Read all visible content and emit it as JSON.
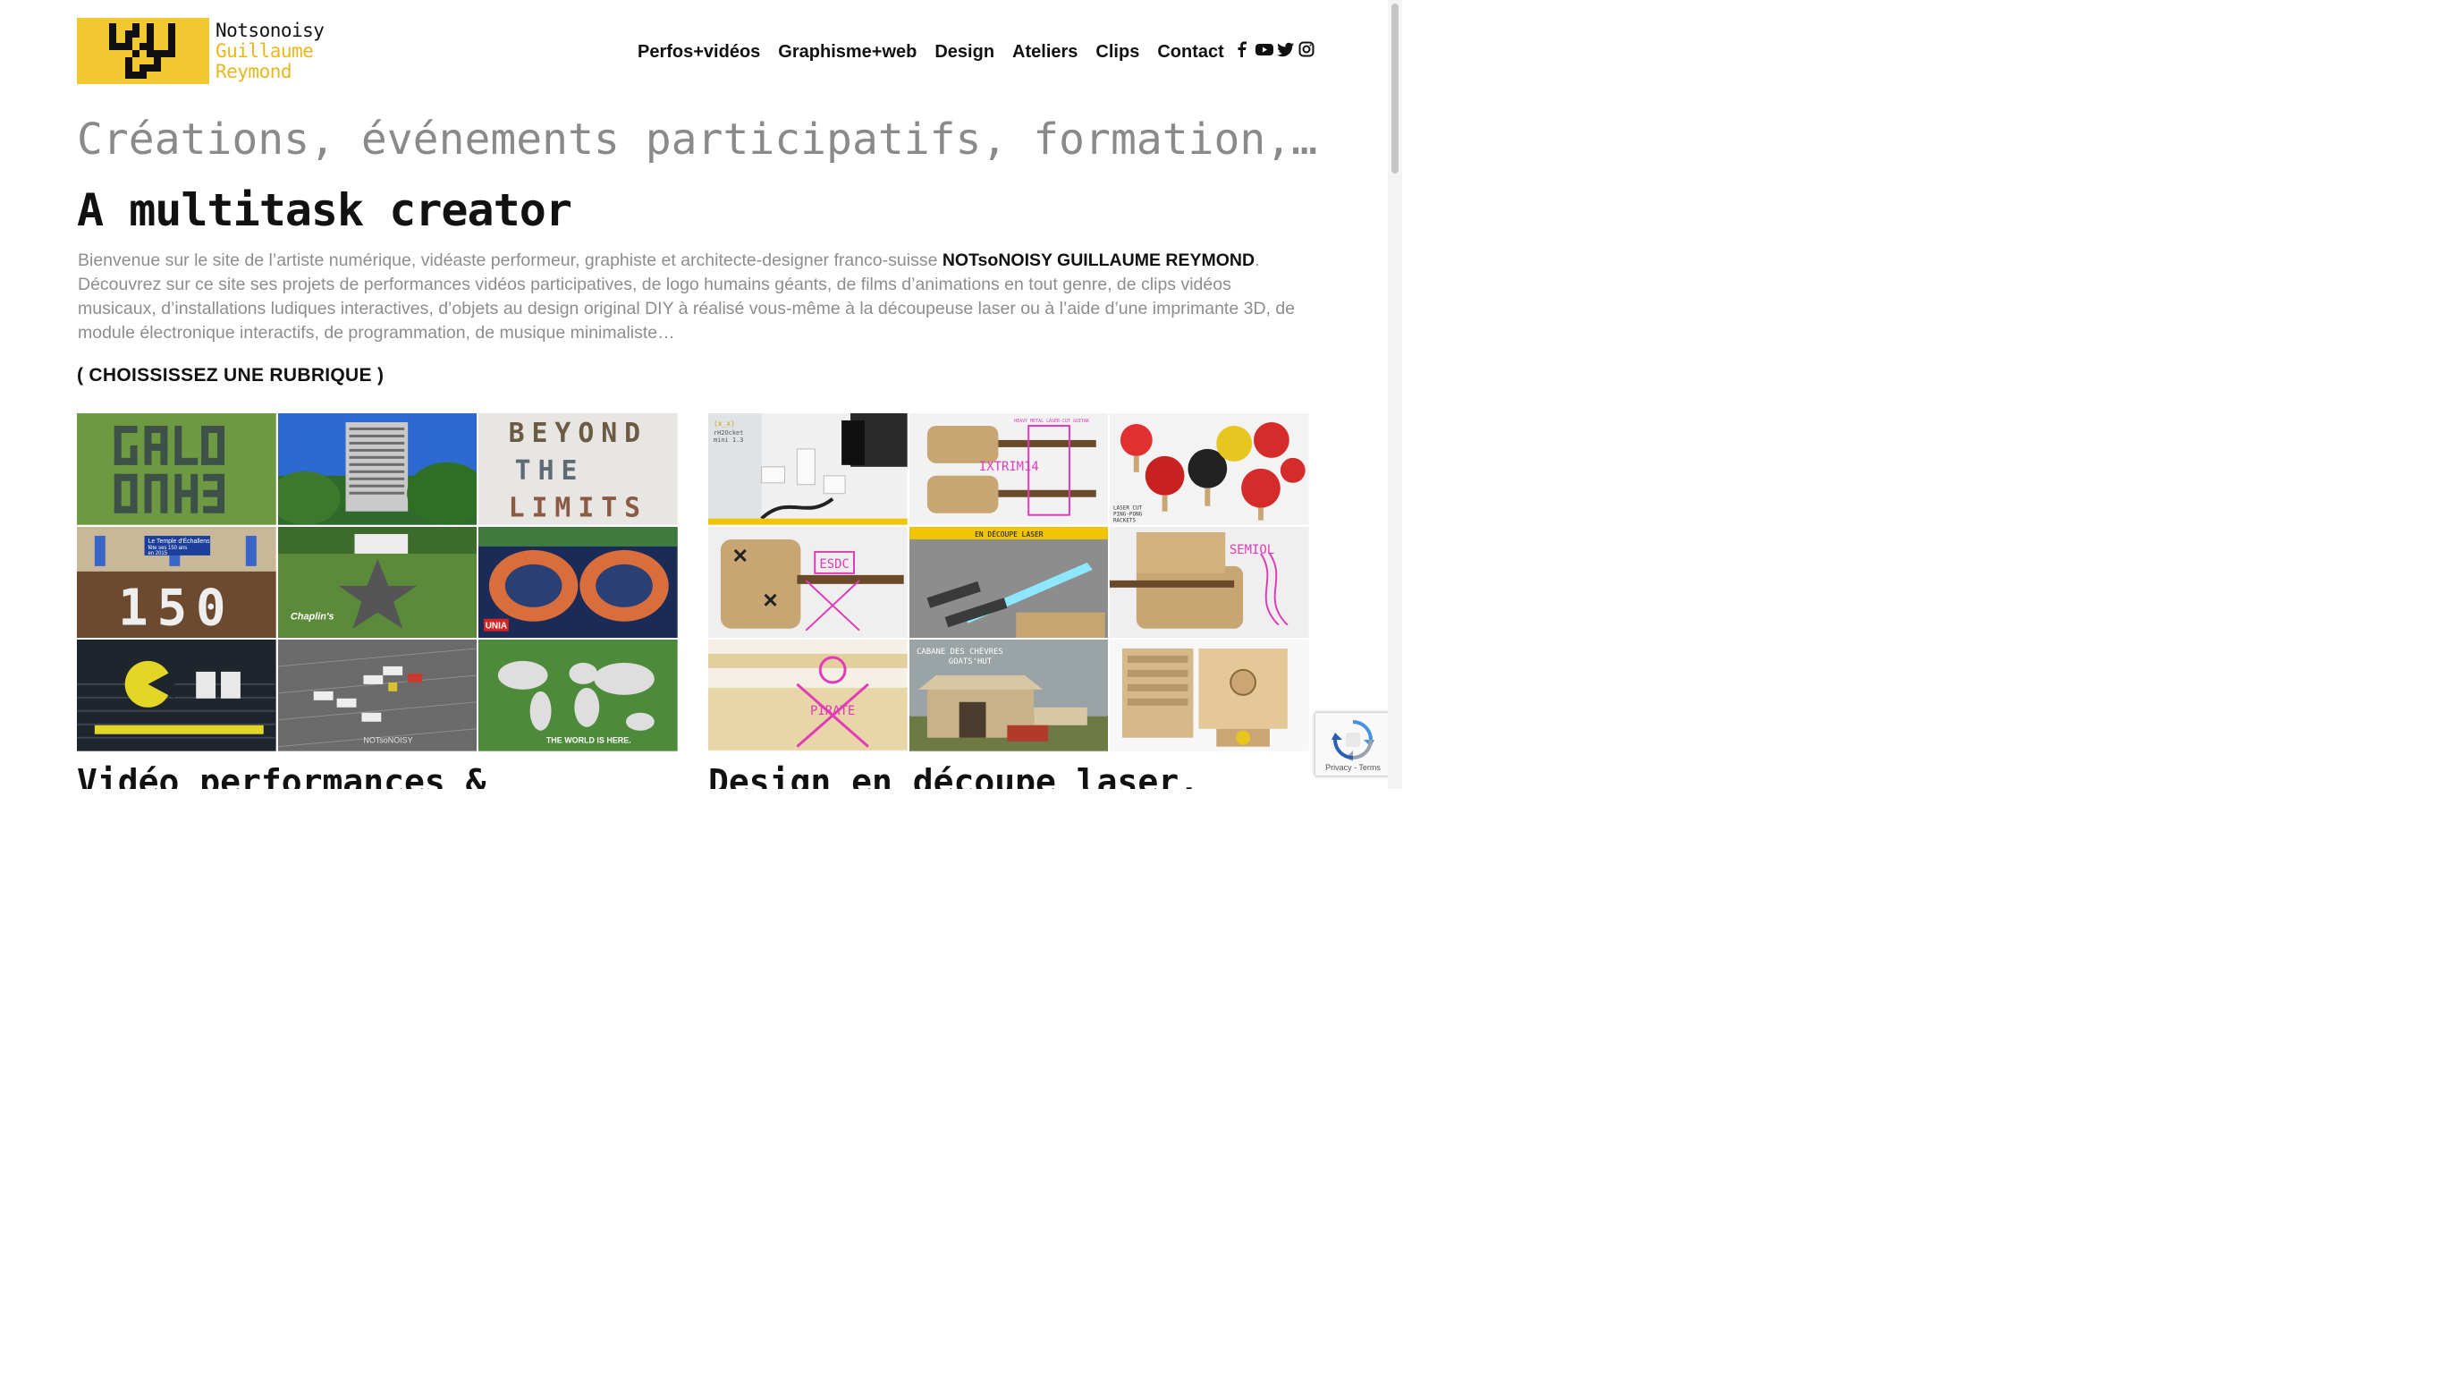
{
  "logo": {
    "line1": "Notsonoisy",
    "line2": "Guillaume",
    "line3": "Reymond",
    "accent": "#f2c832"
  },
  "nav": {
    "items": [
      "Perfos+vidéos",
      "Graphisme+web",
      "Design",
      "Ateliers",
      "Clips",
      "Contact"
    ]
  },
  "social": [
    "facebook-icon",
    "youtube-icon",
    "twitter-icon",
    "instagram-icon"
  ],
  "tagline": "Créations, événements participatifs, formation,…",
  "title": "A multitask creator",
  "intro": {
    "before": "Bienvenue sur le site de l’artiste numérique, vidéaste performeur, graphiste et architecte-designer franco-suisse ",
    "name": "NOTsoNOISY GUILLAUME REYMOND",
    "after": ". Découvrez sur ce site ses projets de performances vidéos participatives, de logo humains géants, de films d’animations en tout genre, de clips vidéos musicaux, d’installations ludiques interactives, d’objets au design original DIY à réalisé vous-même à la découpeuse laser ou à l’aide d’une imprimante 3D, de module électronique interactifs, de programmation, de musique minimaliste…"
  },
  "rubrique": "( CHOISSISSEZ UNE RUBRIQUE )",
  "left_grid": {
    "tiles": [
      {
        "label": "Ga0L logo",
        "caption": ""
      },
      {
        "label": "Tower building",
        "caption": ""
      },
      {
        "label": "BEYOND THE LIMITS",
        "caption": ""
      },
      {
        "label": "Le Temple d'Échallens fête ses 150 ans en 2015",
        "caption": ""
      },
      {
        "label": "Star human logo",
        "caption": "Chaplin's"
      },
      {
        "label": "UNIA",
        "caption": ""
      },
      {
        "label": "Pac-man auditorium",
        "caption": ""
      },
      {
        "label": "Parking cars",
        "caption": "NOTsoNOISY"
      },
      {
        "label": "World map",
        "caption": "THE WORLD IS HERE."
      }
    ]
  },
  "right_grid": {
    "tiles": [
      {
        "label": "(x_x) rH2Ocket mini 1.3"
      },
      {
        "label": "IXTRIM14"
      },
      {
        "label": "LASER CUT PING-PONG RACKETS"
      },
      {
        "label": "ESDC"
      },
      {
        "label": "EN DÉCOUPE LASER"
      },
      {
        "label": "SEMIOL..."
      },
      {
        "label": "PIRATE"
      },
      {
        "label": "CABANE DES CHÈVRES GOATS' HUT"
      },
      {
        "label": "Wooden mechanism"
      }
    ]
  },
  "bottom_titles": {
    "left": "Vidéo performances &",
    "right": "Design en découpe laser,"
  },
  "recaptcha": {
    "links": "Privacy - Terms"
  }
}
